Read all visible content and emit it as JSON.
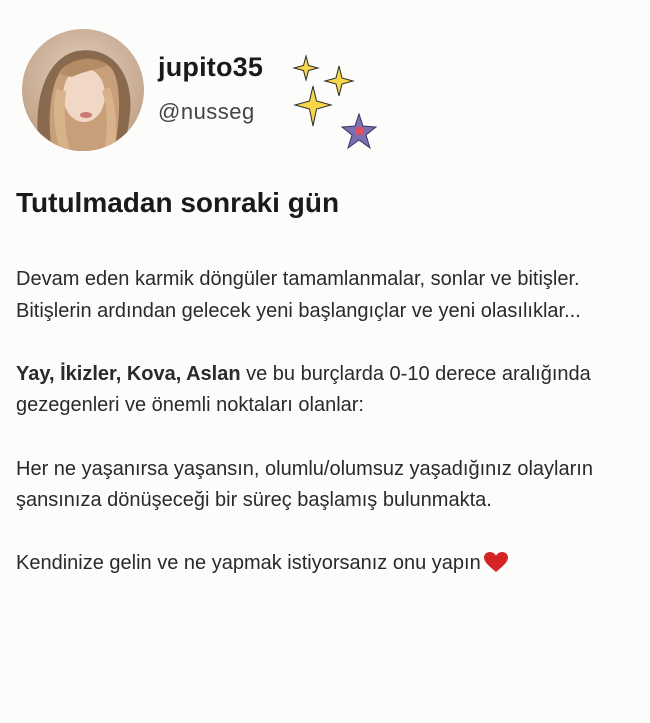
{
  "profile": {
    "display_name": "jupito35",
    "handle": "@nusseg"
  },
  "post": {
    "title": "Tutulmadan sonraki gün",
    "paragraph1_line1": "Devam eden karmik döngüler tamamlanmalar, sonlar ve bitişler.",
    "paragraph1_line2": "Bitişlerin ardından gelecek yeni başlangıçlar ve yeni olasılıklar...",
    "paragraph2_bold": "Yay, İkizler, Kova, Aslan",
    "paragraph2_rest": " ve bu burçlarda 0-10 derece aralığında gezegenleri ve önemli noktaları olanlar:",
    "paragraph3": "Her ne yaşanırsa yaşansın, olumlu/olumsuz yaşadığınız olayların şansınıza dönüşeceği bir süreç  başlamış bulunmakta.",
    "paragraph4": "Kendinize gelin ve ne yapmak istiyorsanız onu yapın"
  },
  "icons": {
    "sparkle": "sparkle-icon",
    "star": "purple-star-icon",
    "heart": "heart-icon"
  },
  "colors": {
    "sparkle_fill": "#f7d64a",
    "star_fill": "#7a6fb0",
    "heart_fill": "#d42424"
  }
}
